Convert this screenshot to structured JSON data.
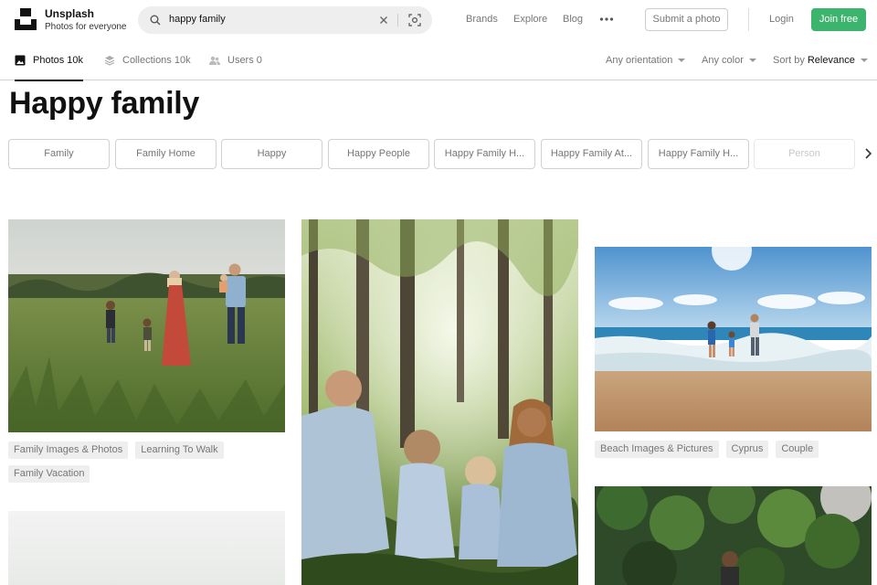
{
  "header": {
    "brand_name": "Unsplash",
    "brand_tagline": "Photos for everyone",
    "search_value": "happy family",
    "nav": [
      "Brands",
      "Explore",
      "Blog"
    ],
    "submit_label": "Submit a photo",
    "login_label": "Login",
    "join_label": "Join free",
    "accent": "#3cb46e"
  },
  "tabs": {
    "photos": "Photos 10k",
    "collections": "Collections 10k",
    "users": "Users 0"
  },
  "filters": {
    "orientation": "Any orientation",
    "color": "Any color",
    "sort_prefix": "Sort by",
    "sort_value": "Relevance"
  },
  "page_title": "Happy family",
  "related": [
    "Family",
    "Family Home",
    "Happy",
    "Happy People",
    "Happy Family H...",
    "Happy Family At...",
    "Happy Family H...",
    "Person"
  ],
  "photos": {
    "col1_tags_row1": [
      "Family Images & Photos",
      "Learning To Walk"
    ],
    "col1_tags_row2": [
      "Family Vacation"
    ],
    "col3_tags": [
      "Beach Images & Pictures",
      "Cyprus",
      "Couple"
    ]
  }
}
